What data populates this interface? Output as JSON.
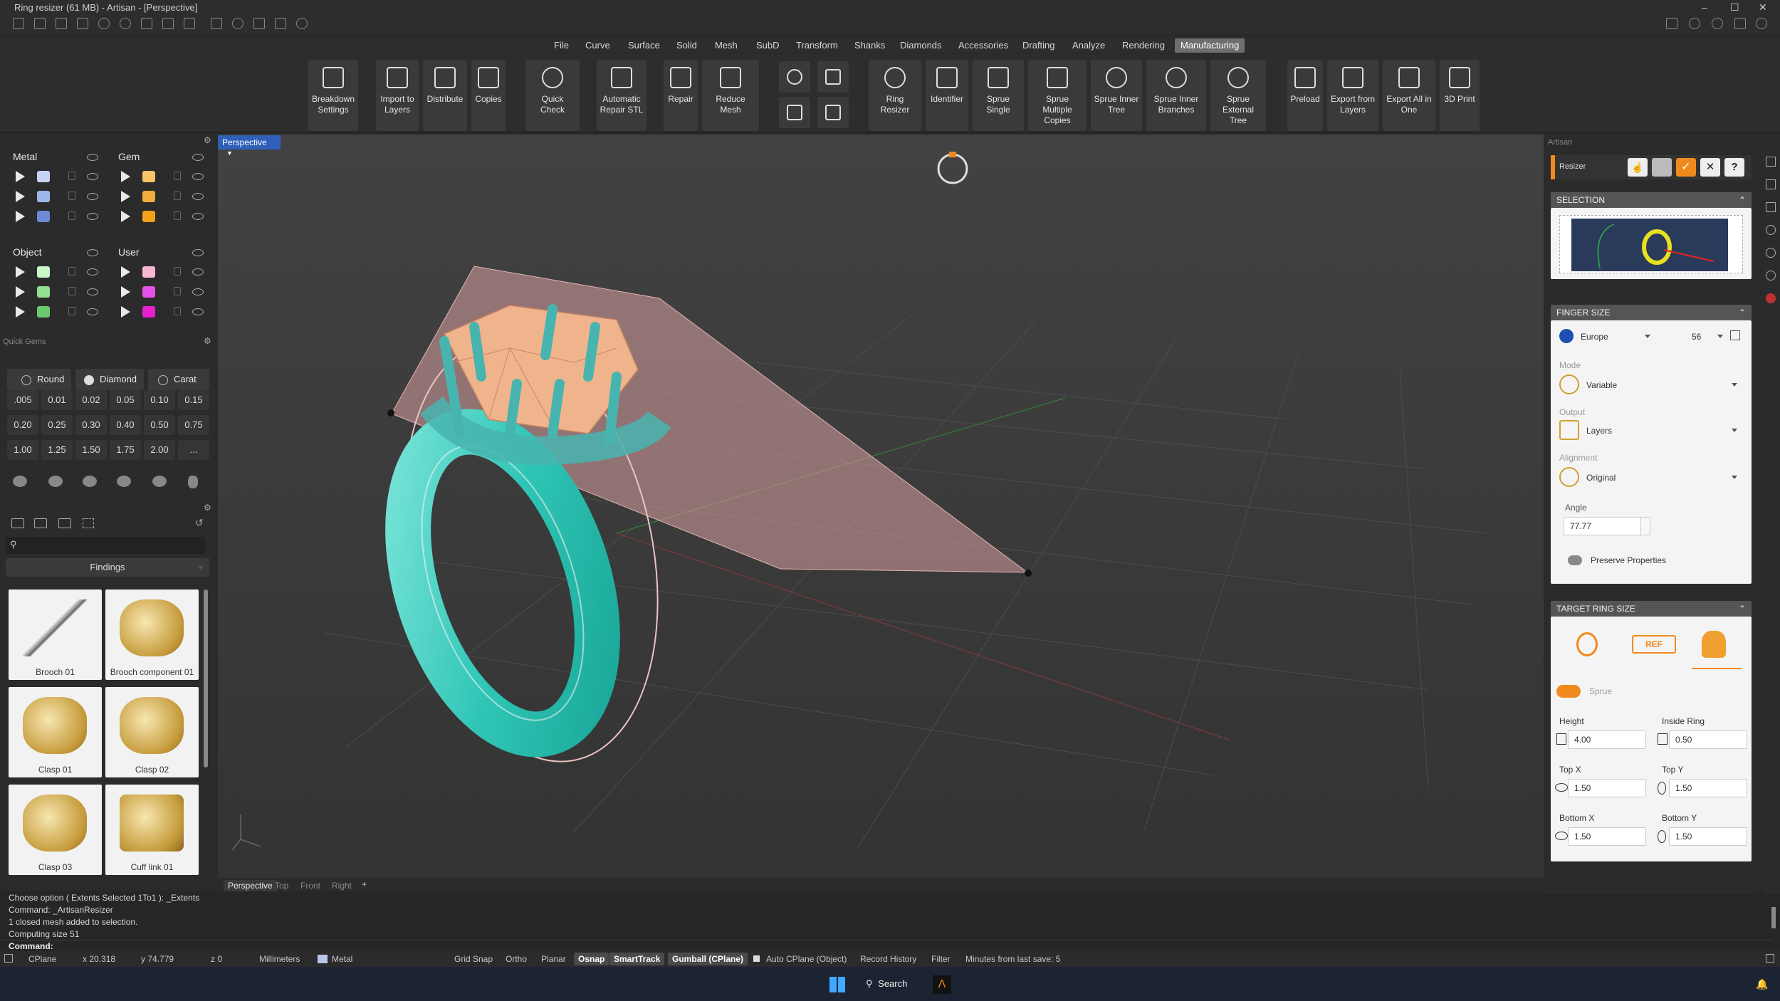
{
  "window": {
    "title": "Ring resizer (61 MB) - Artisan - [Perspective]"
  },
  "menu": {
    "tabs": [
      "File",
      "Curve",
      "Surface",
      "Solid",
      "Mesh",
      "SubD",
      "Transform",
      "Shanks",
      "Diamonds",
      "Accessories",
      "Drafting",
      "Analyze",
      "Rendering",
      "Manufacturing"
    ],
    "active": "Manufacturing"
  },
  "ribbon": {
    "buttons": [
      {
        "label": "Breakdown Settings",
        "icon": "breakdown-icon"
      },
      {
        "label": "Import to Layers",
        "icon": "import-icon"
      },
      {
        "label": "Distribute",
        "icon": "distribute-icon"
      },
      {
        "label": "Copies",
        "icon": "copies-icon"
      },
      {
        "label": "Quick Check",
        "icon": "quick-check-icon"
      },
      {
        "label": "Automatic Repair STL",
        "icon": "magic-wand-icon"
      },
      {
        "label": "Repair",
        "icon": "wrench-icon"
      },
      {
        "label": "Reduce Mesh",
        "icon": "mesh-icon"
      },
      {
        "label": "Ring Resizer",
        "icon": "ring-resizer-icon"
      },
      {
        "label": "Identifier",
        "icon": "ref-icon"
      },
      {
        "label": "Sprue Single",
        "icon": "sprue-icon"
      },
      {
        "label": "Sprue Multiple Copies",
        "icon": "sprue-tree-icon"
      },
      {
        "label": "Sprue Inner Tree",
        "icon": "sprue-inner-icon"
      },
      {
        "label": "Sprue Inner Branches",
        "icon": "sprue-branch-icon"
      },
      {
        "label": "Sprue External Tree",
        "icon": "sprue-external-icon"
      },
      {
        "label": "Preload",
        "icon": "preload-icon"
      },
      {
        "label": "Export from Layers",
        "icon": "export-layers-icon"
      },
      {
        "label": "Export All in One",
        "icon": "export-all-icon"
      },
      {
        "label": "3D Print",
        "icon": "printer-icon"
      }
    ]
  },
  "layers": {
    "metal": {
      "title": "Metal",
      "colors": [
        "#c6d4f5",
        "#9fb8ea",
        "#6e8ad6"
      ]
    },
    "gem": {
      "title": "Gem",
      "colors": [
        "#f7c46a",
        "#f2ae3e",
        "#f0a21c"
      ]
    },
    "object": {
      "title": "Object",
      "colors": [
        "#c9f5c9",
        "#8fe08f",
        "#6cc96c"
      ]
    },
    "user": {
      "title": "User",
      "colors": [
        "#f7b7d2",
        "#e452e8",
        "#e81fd1"
      ]
    }
  },
  "quick_gems": {
    "title": "Quick Gems",
    "tabs": [
      "Round",
      "Diamond",
      "Carat"
    ],
    "sizes": [
      ".005",
      "0.01",
      "0.02",
      "0.05",
      "0.10",
      "0.15",
      "0.20",
      "0.25",
      "0.30",
      "0.40",
      "0.50",
      "0.75",
      "1.00",
      "1.25",
      "1.50",
      "1.75",
      "2.00",
      "..."
    ]
  },
  "library": {
    "category": "Findings",
    "items": [
      "Brooch 01",
      "Brooch component 01",
      "Clasp 01",
      "Clasp 02",
      "Clasp 03",
      "Cuff link 01"
    ]
  },
  "viewport": {
    "name": "Perspective",
    "tabs": [
      "Perspective",
      "Top",
      "Front",
      "Right",
      "+"
    ]
  },
  "command": {
    "lines": [
      "Choose option ( Extents  Selected  1To1 ): _Extents",
      "Command: _ArtisanResizer",
      "1 closed mesh added to selection.",
      "Computing size 51"
    ],
    "prompt": "Command:"
  },
  "status": {
    "cplane": "CPlane",
    "x": "x 20.318",
    "y": "y 74.779",
    "z": "z 0",
    "units": "Millimeters",
    "layer": "Metal",
    "layer_color": "#b9c6ea",
    "toggles": [
      "Grid Snap",
      "Ortho",
      "Planar"
    ],
    "active_toggles": [
      "Osnap",
      "SmartTrack",
      "Gumball (CPlane)"
    ],
    "extra": [
      "Auto CPlane (Object)",
      "Record History",
      "Filter",
      "Minutes from last save: 5"
    ]
  },
  "taskbar": {
    "search": "Search"
  },
  "artisan": {
    "panel_title": "Artisan",
    "tool": "Resizer",
    "selection": {
      "header": "SELECTION"
    },
    "finger_size": {
      "header": "FINGER SIZE",
      "region": "Europe",
      "size": "56",
      "mode_label": "Mode",
      "mode": "Variable",
      "output_label": "Output",
      "output": "Layers",
      "alignment_label": "Alignment",
      "alignment": "Original",
      "angle_label": "Angle",
      "angle": "77.77",
      "preserve": "Preserve Properties"
    },
    "target": {
      "header": "TARGET RING SIZE",
      "sprue_label": "Sprue",
      "height_label": "Height",
      "height": "4.00",
      "inside_label": "Inside Ring",
      "inside": "0.50",
      "topx_label": "Top X",
      "topx": "1.50",
      "topy_label": "Top Y",
      "topy": "1.50",
      "botx_label": "Bottom X",
      "botx": "1.50",
      "boty_label": "Bottom Y",
      "boty": "1.50"
    }
  },
  "colors": {
    "accent": "#f08a1c",
    "ring": "#40d0c0",
    "gem": "#f0b48c",
    "cut_plane": "#d9a1a1"
  }
}
